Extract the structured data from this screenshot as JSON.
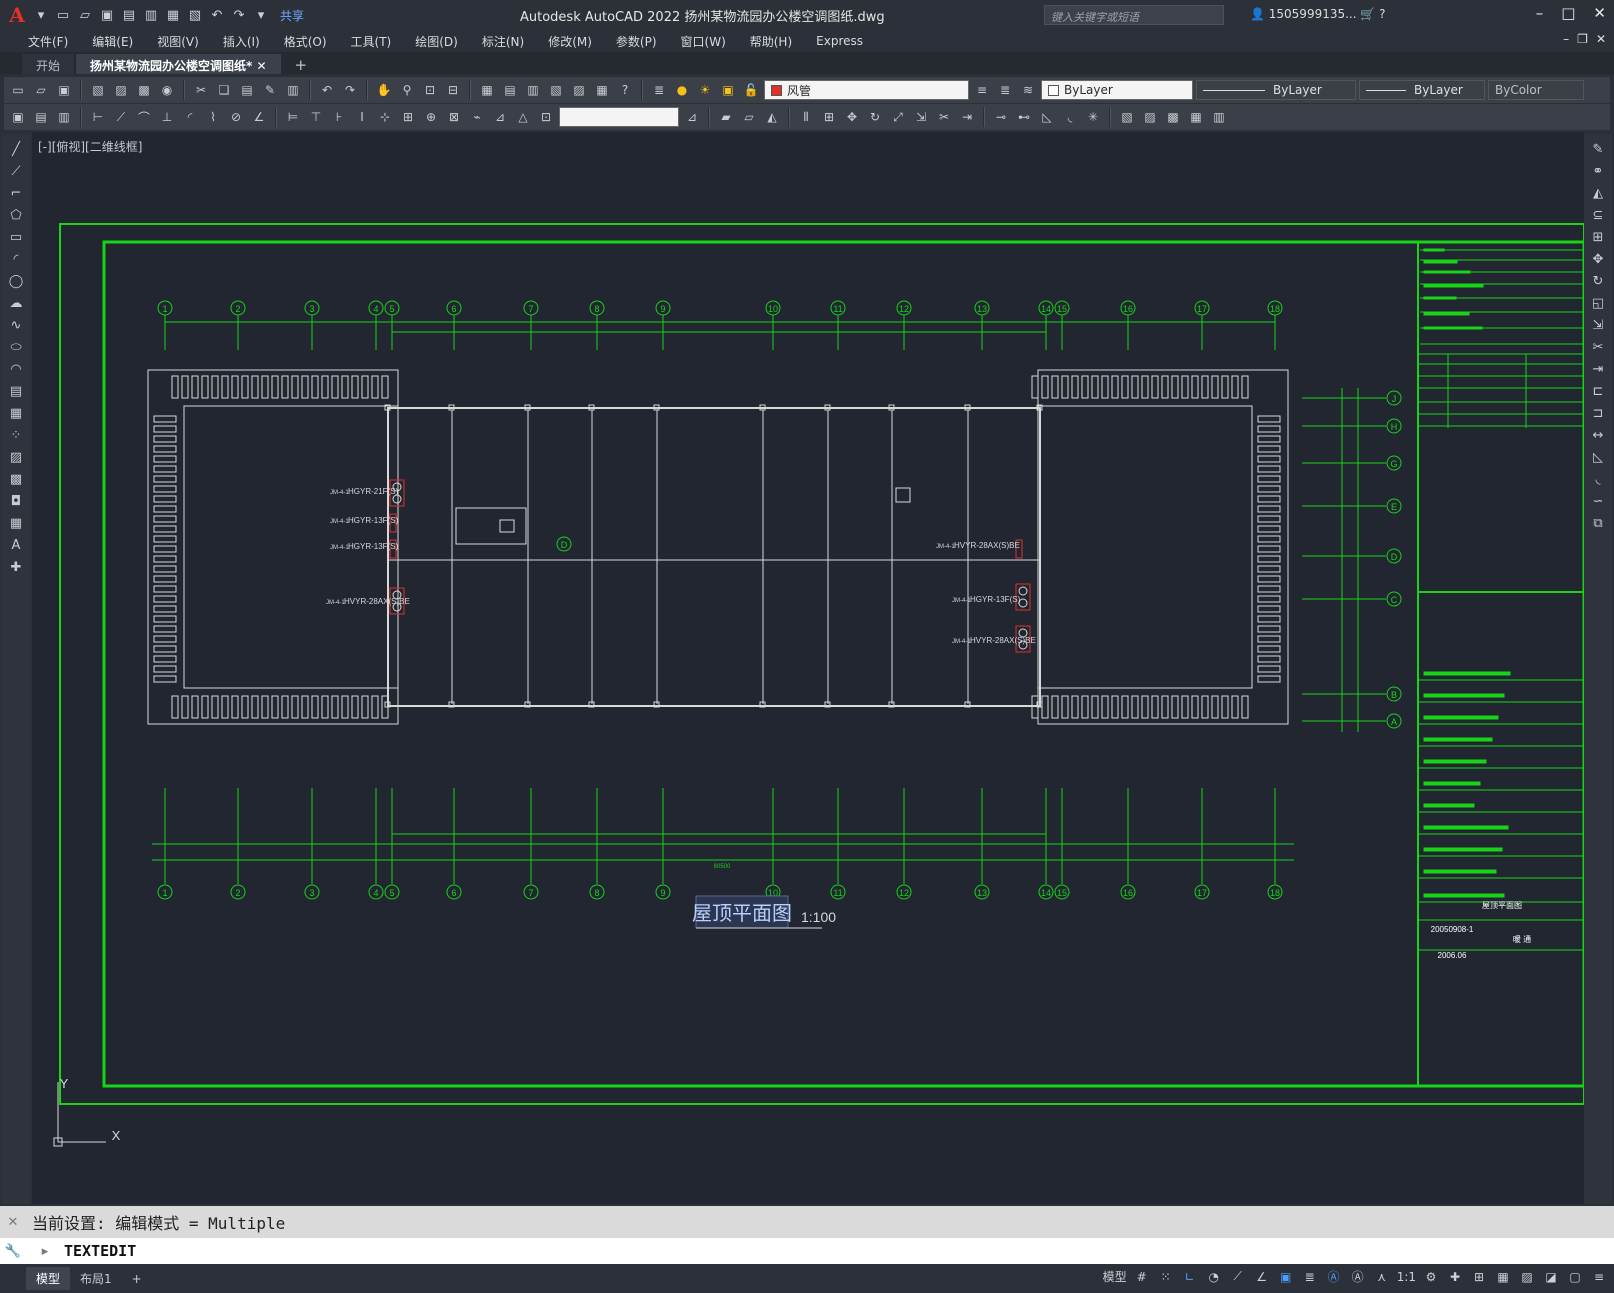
{
  "app": {
    "logo": "A",
    "title": "Autodesk AutoCAD 2022    扬州某物流园办公楼空调图纸.dwg",
    "search_placeholder": "键入关键字或短语",
    "user": "1505999135...",
    "share_label": "共享"
  },
  "menu": [
    "文件(F)",
    "编辑(E)",
    "视图(V)",
    "插入(I)",
    "格式(O)",
    "工具(T)",
    "绘图(D)",
    "标注(N)",
    "修改(M)",
    "参数(P)",
    "窗口(W)",
    "帮助(H)",
    "Express"
  ],
  "tabs": [
    {
      "label": "开始"
    },
    {
      "label": "扬州某物流园办公楼空调图纸*"
    }
  ],
  "properties": {
    "layer": "风管",
    "color": "ByLayer",
    "linetype": "ByLayer",
    "lineweight": "ByLayer",
    "plotstyle": "ByColor"
  },
  "viewport_label": "[-][俯视][二维线框]",
  "drawing": {
    "title": "屋顶平面图",
    "scale": "1:100",
    "grid_top": [
      "1",
      "2",
      "3",
      "4",
      "5",
      "6",
      "7",
      "8",
      "9",
      "10",
      "11",
      "12",
      "13",
      "14",
      "15",
      "16",
      "17",
      "18"
    ],
    "grid_right": [
      "J",
      "H",
      "G",
      "E",
      "D",
      "C",
      "B",
      "A"
    ],
    "equipment_labels": [
      "HGYR-21F(S)",
      "HGYR-13F(S)",
      "HGYR-13F(S)",
      "HVYR-28AX(S)BE",
      "HGYR-13F(S)",
      "HVYR-28AX(S)BE",
      "HVYR-28AX(S)BE"
    ],
    "unit_tags": [
      "JM-4-1",
      "JM-4-1",
      "JM-4-1",
      "JM-4-1",
      "JM-4-1",
      "JM-4-1",
      "JM-4-1"
    ],
    "title_block": {
      "sheet_name": "屋顶平面图",
      "drawing_no": "20050908-1",
      "date": "2006.06",
      "stage": "暖 通"
    },
    "dim_total": "60500"
  },
  "command": {
    "history": "当前设置: 编辑模式 = Multiple",
    "current": "TEXTEDIT"
  },
  "layout_tabs": [
    "模型",
    "布局1"
  ],
  "status": {
    "model": "模型",
    "scale": "1:1"
  },
  "colors": {
    "cad_green": "#17d417",
    "background": "#212630",
    "accent": "#4aa0ff",
    "red": "#e0302a"
  }
}
